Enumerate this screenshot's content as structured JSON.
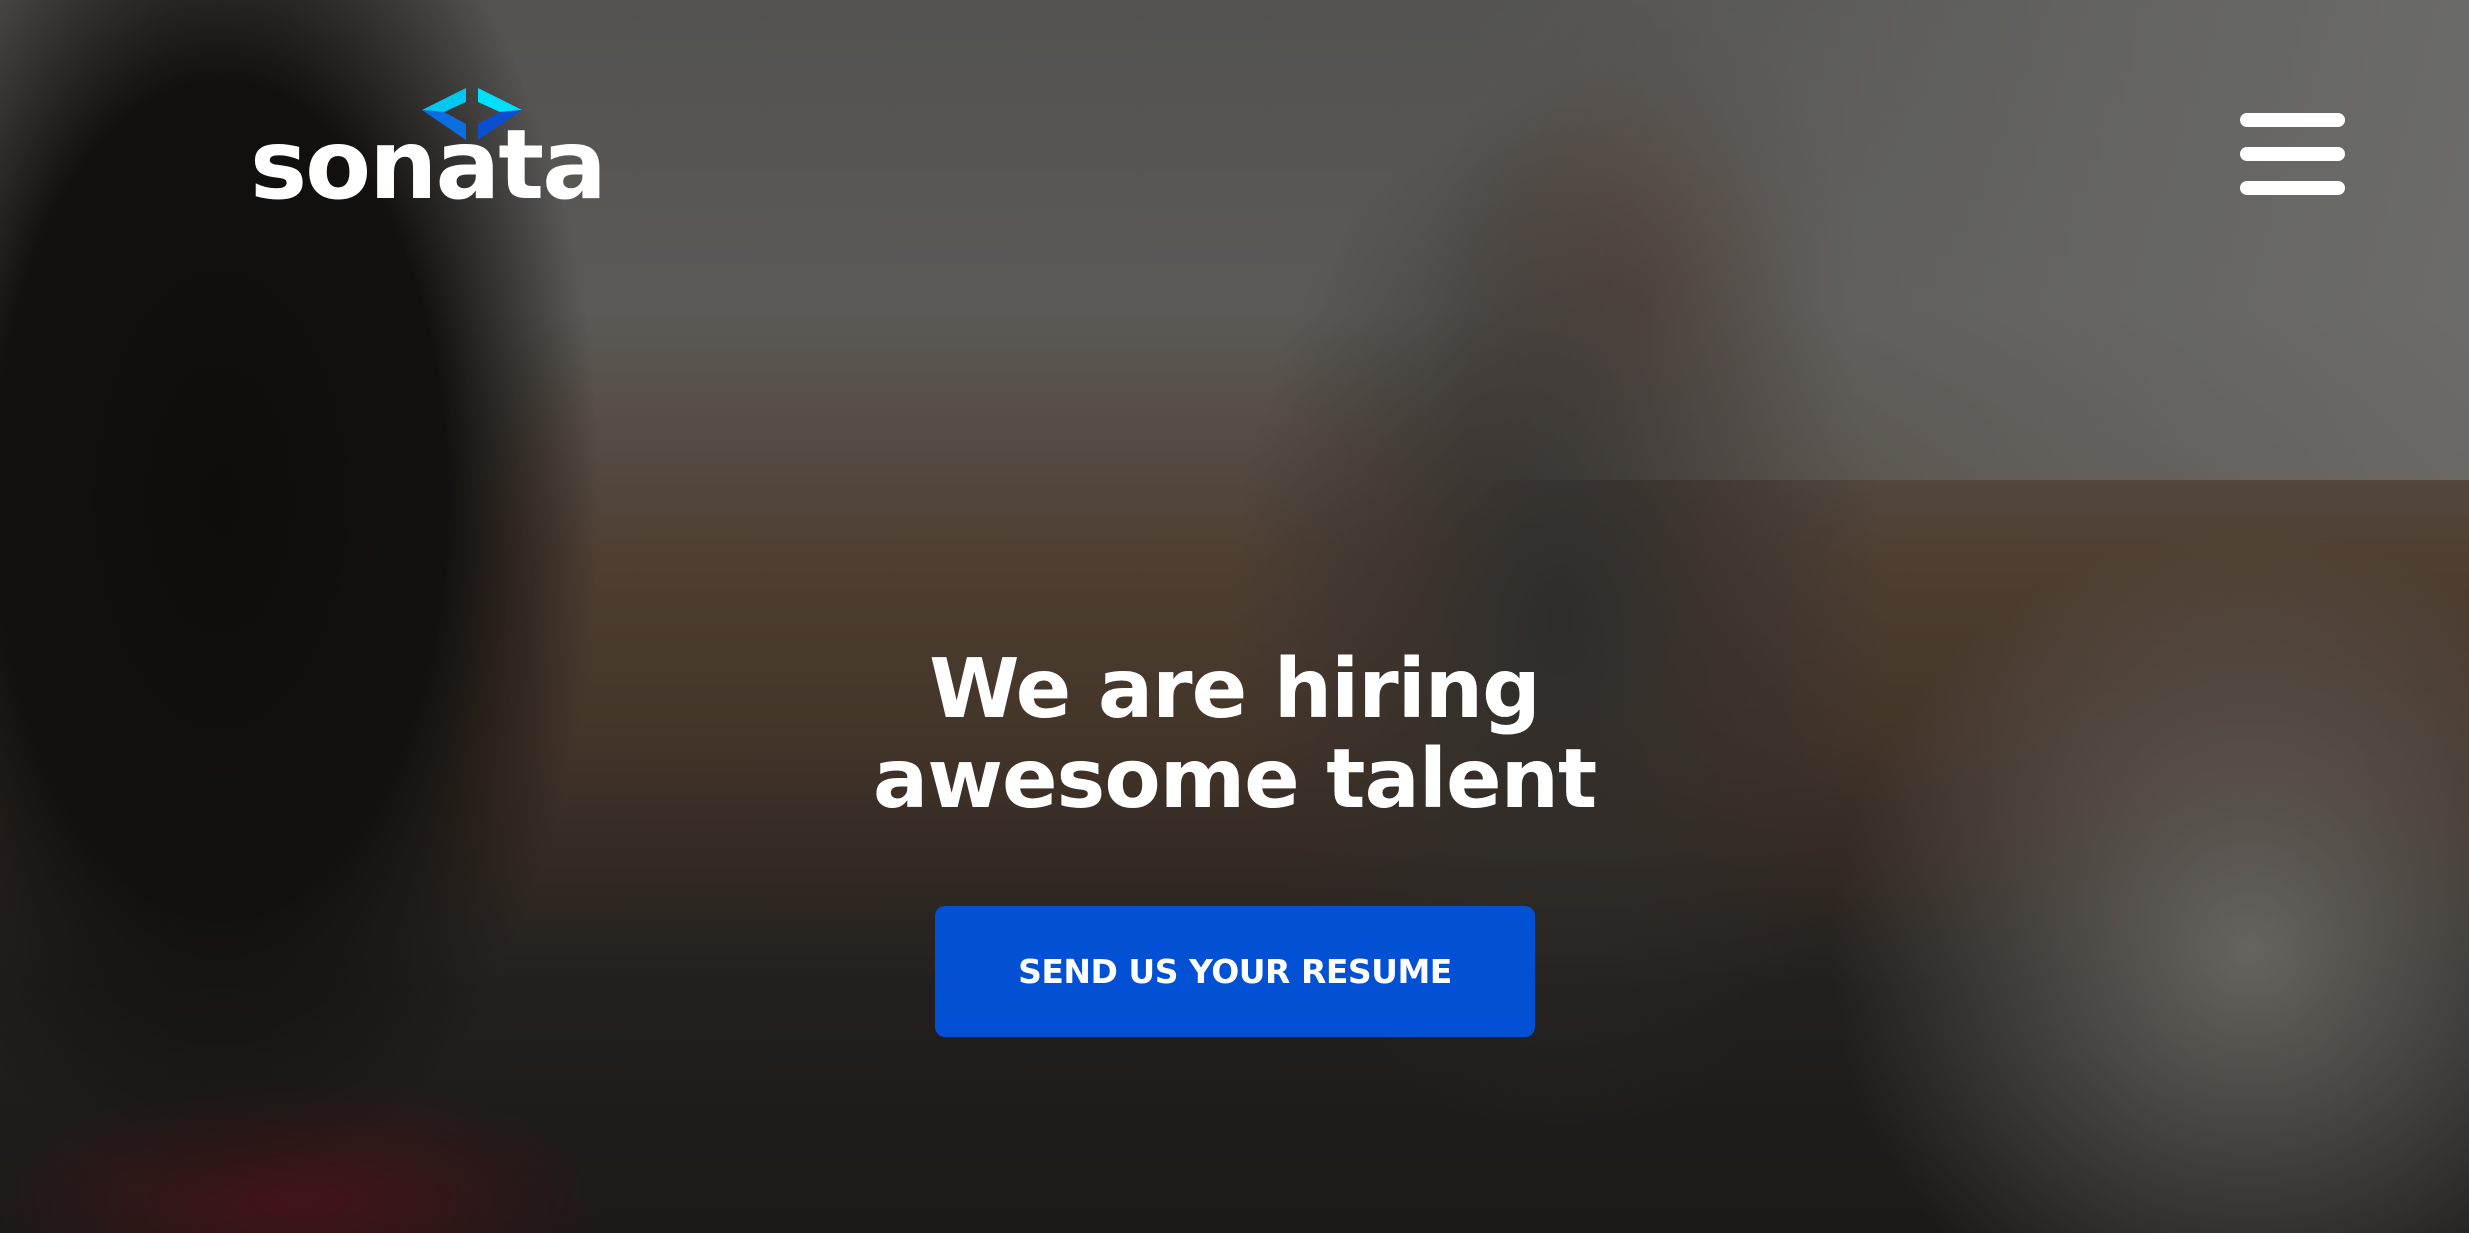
{
  "header": {
    "logo_text": "sonata",
    "logo_icon": "diamond-brackets-icon",
    "menu_icon": "hamburger-menu-icon",
    "brand_colors": {
      "icon_light": "#00d8f5",
      "icon_dark": "#0a5fd6"
    }
  },
  "hero": {
    "headline_line1": "We are hiring",
    "headline_line2": "awesome talent",
    "cta_label": "SEND US YOUR RESUME",
    "cta_color": "#0250d4"
  }
}
